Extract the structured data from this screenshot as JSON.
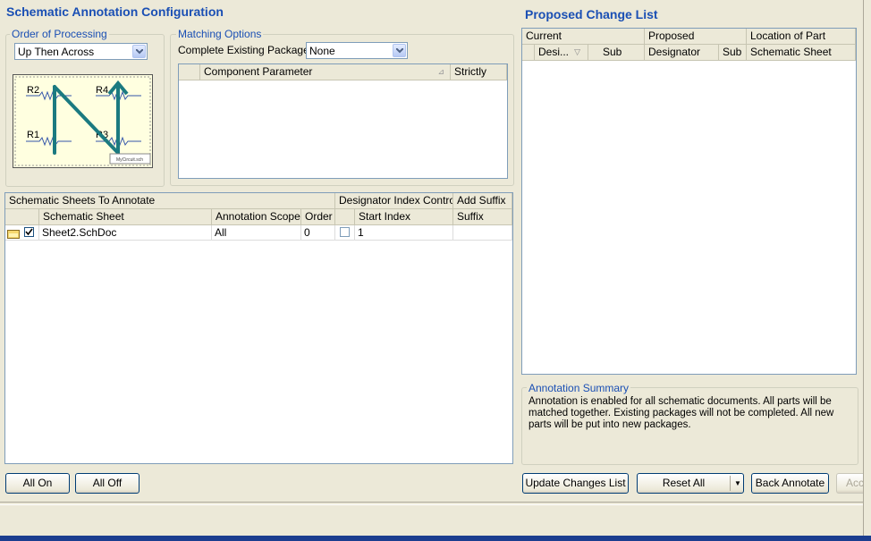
{
  "dialog_title": "Schematic Annotation Configuration",
  "order_of_processing": {
    "label": "Order of Processing",
    "selected": "Up Then Across",
    "preview": {
      "labels": [
        "R2",
        "R4",
        "R1",
        "R3"
      ],
      "caption": "MyCircuit.sch"
    }
  },
  "matching_options": {
    "label": "Matching Options",
    "complete_packages_label": "Complete Existing Packages",
    "complete_packages_value": "None",
    "columns": [
      "Component Parameter",
      "Strictly"
    ]
  },
  "sheets_table": {
    "group_headers": [
      "Schematic Sheets To Annotate",
      "Designator Index Control",
      "Add Suffix"
    ],
    "columns": [
      "Schematic Sheet",
      "Annotation Scope",
      "Order",
      "Start Index",
      "Suffix"
    ],
    "rows": [
      {
        "checked": true,
        "sheet": "Sheet2.SchDoc",
        "scope": "All",
        "order": "0",
        "index_enabled": false,
        "start_index": "1",
        "suffix": ""
      }
    ]
  },
  "proposed": {
    "title": "Proposed Change List",
    "group_headers": [
      "Current",
      "Proposed",
      "Location of Part"
    ],
    "columns": [
      "Desi...",
      "Sub",
      "Designator",
      "Sub",
      "Schematic Sheet"
    ]
  },
  "annotation_summary": {
    "label": "Annotation Summary",
    "text": "Annotation is enabled for all schematic documents. All parts will be matched together. Existing packages will not be completed. All new parts will be put into new packages."
  },
  "buttons": {
    "all_on": "All On",
    "all_off": "All Off",
    "update_changes": "Update Changes List",
    "reset_all": "Reset All",
    "back_annotate": "Back Annotate",
    "accept": "Acc"
  },
  "colors": {
    "accent": "#1a4fb4",
    "wire": "#1b7a80",
    "preview_bg": "#ffffe0"
  }
}
